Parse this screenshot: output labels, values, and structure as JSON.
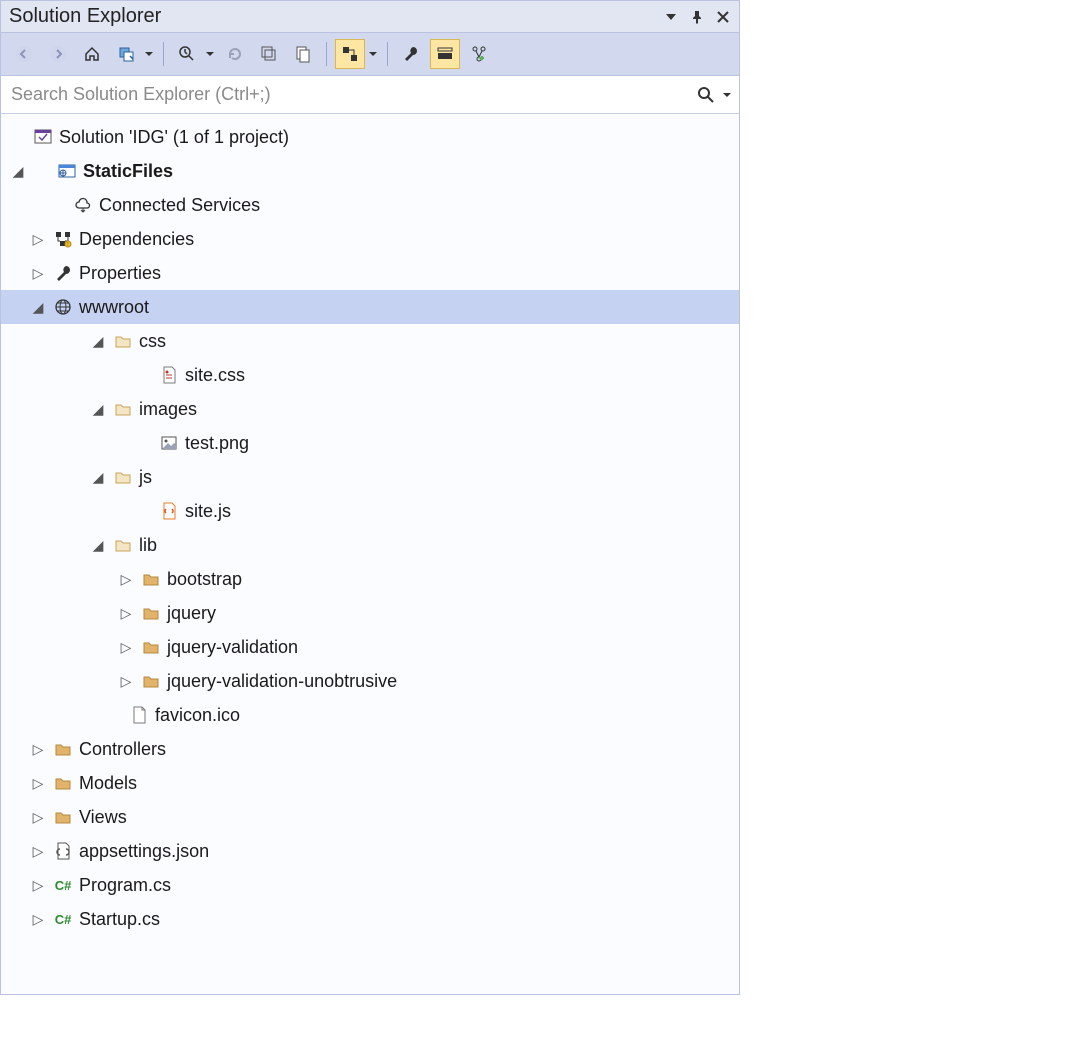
{
  "panel": {
    "title": "Solution Explorer",
    "search_placeholder": "Search Solution Explorer (Ctrl+;)"
  },
  "toolbar": {
    "back": "Back",
    "forward": "Forward",
    "home": "Home",
    "sync": "Sync with Active Document",
    "pending": "Pending Changes Filter",
    "refresh": "Refresh",
    "collapse": "Collapse All",
    "show_all": "Show All Files",
    "scope": "Scope to This",
    "properties": "Properties",
    "preview": "Preview Selected Items",
    "class_view": "View Class Diagram"
  },
  "tree": {
    "solution": "Solution 'IDG' (1 of 1 project)",
    "project": "StaticFiles",
    "connected_services": "Connected Services",
    "dependencies": "Dependencies",
    "properties": "Properties",
    "wwwroot": "wwwroot",
    "css": "css",
    "site_css": "site.css",
    "images": "images",
    "test_png": "test.png",
    "js": "js",
    "site_js": "site.js",
    "lib": "lib",
    "bootstrap": "bootstrap",
    "jquery": "jquery",
    "jquery_validation": "jquery-validation",
    "jquery_validation_unobtrusive": "jquery-validation-unobtrusive",
    "favicon": "favicon.ico",
    "controllers": "Controllers",
    "models": "Models",
    "views": "Views",
    "appsettings": "appsettings.json",
    "program": "Program.cs",
    "startup": "Startup.cs"
  }
}
